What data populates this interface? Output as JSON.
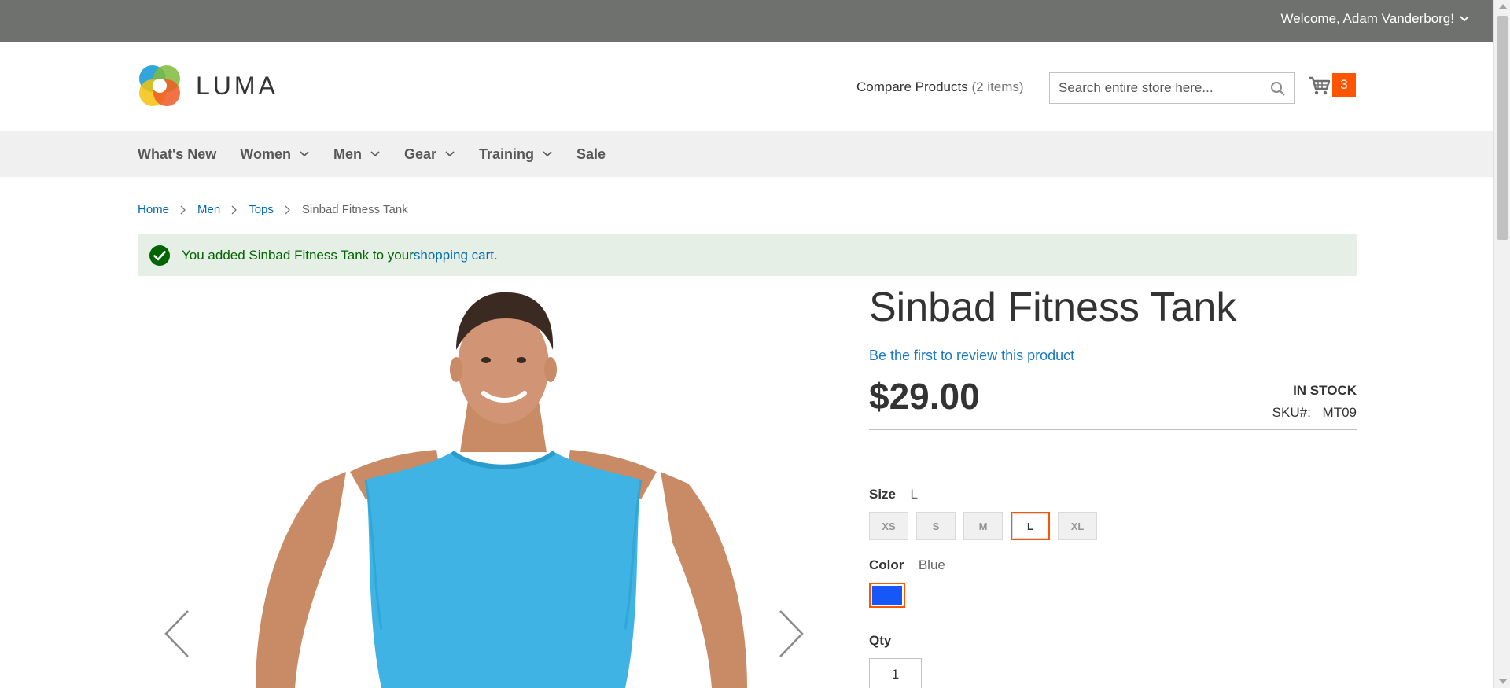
{
  "top_bar": {
    "welcome_text": "Welcome, Adam Vanderborg!"
  },
  "header": {
    "logo_text": "LUMA",
    "compare_label": "Compare Products",
    "compare_count": "(2 items)",
    "search_placeholder": "Search entire store here...",
    "cart_count": "3"
  },
  "nav": {
    "items": [
      {
        "label": "What's New",
        "has_dropdown": false
      },
      {
        "label": "Women",
        "has_dropdown": true
      },
      {
        "label": "Men",
        "has_dropdown": true
      },
      {
        "label": "Gear",
        "has_dropdown": true
      },
      {
        "label": "Training",
        "has_dropdown": true
      },
      {
        "label": "Sale",
        "has_dropdown": false
      }
    ]
  },
  "breadcrumb": {
    "items": [
      "Home",
      "Men",
      "Tops"
    ],
    "current": "Sinbad Fitness Tank"
  },
  "message": {
    "text_before": "You added Sinbad Fitness Tank to your ",
    "link_text": "shopping cart",
    "text_after": "."
  },
  "product": {
    "title": "Sinbad Fitness Tank",
    "review_link": "Be the first to review this product",
    "price": "$29.00",
    "stock": "IN STOCK",
    "sku_label": "SKU#:",
    "sku_value": "MT09",
    "size_label": "Size",
    "size_selected": "L",
    "sizes": [
      "XS",
      "S",
      "M",
      "L",
      "XL"
    ],
    "color_label": "Color",
    "color_selected": "Blue",
    "color_hex": "#1857f7",
    "qty_label": "Qty",
    "qty_value": "1"
  },
  "colors": {
    "top_bar": "#6e716e",
    "accent": "#ff5501",
    "link": "#006bb4",
    "success_bg": "#e5efe5",
    "success_text": "#006400"
  }
}
